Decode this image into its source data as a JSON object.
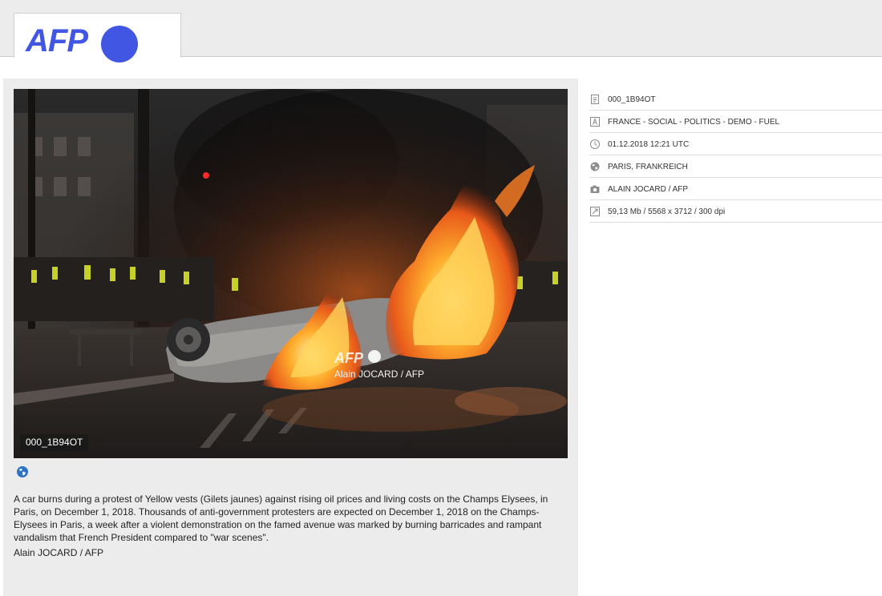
{
  "header": {
    "logo_text": "AFP",
    "logo_color": "#4256e4",
    "logo_dot_color": "#4256e4"
  },
  "photo": {
    "alt": "A car burns during a protest of Yellow vests on the Champs Elysees, Paris",
    "watermark_logo": "AFP",
    "watermark_credit": "Alain JOCARD / AFP",
    "id_badge": "000_1B94OT"
  },
  "globe_icon": "globe-icon",
  "caption": {
    "text": "A car burns during a protest of Yellow vests (Gilets jaunes) against rising oil prices and living costs on the Champs Elysees, in Paris, on December 1, 2018. Thousands of anti-government protesters are expected on December 1, 2018 on the Champs-Elysees in Paris, a week after a violent demonstration on the famed avenue was marked by burning barricades and rampant vandalism that French President compared to \"war scenes\".",
    "credit": "Alain JOCARD / AFP"
  },
  "metadata": {
    "id": "000_1B94OT",
    "keywords": "FRANCE - SOCIAL - POLITICS - DEMO - FUEL",
    "date": "01.12.2018 12:21 UTC",
    "location": "PARIS, FRANKREICH",
    "photographer": "ALAIN JOCARD / AFP",
    "file_info": "59,13 Mb / 5568 x 3712 / 300 dpi",
    "icons": [
      "document-icon",
      "text-icon",
      "clock-icon",
      "globe-icon",
      "camera-icon",
      "resize-icon"
    ]
  }
}
